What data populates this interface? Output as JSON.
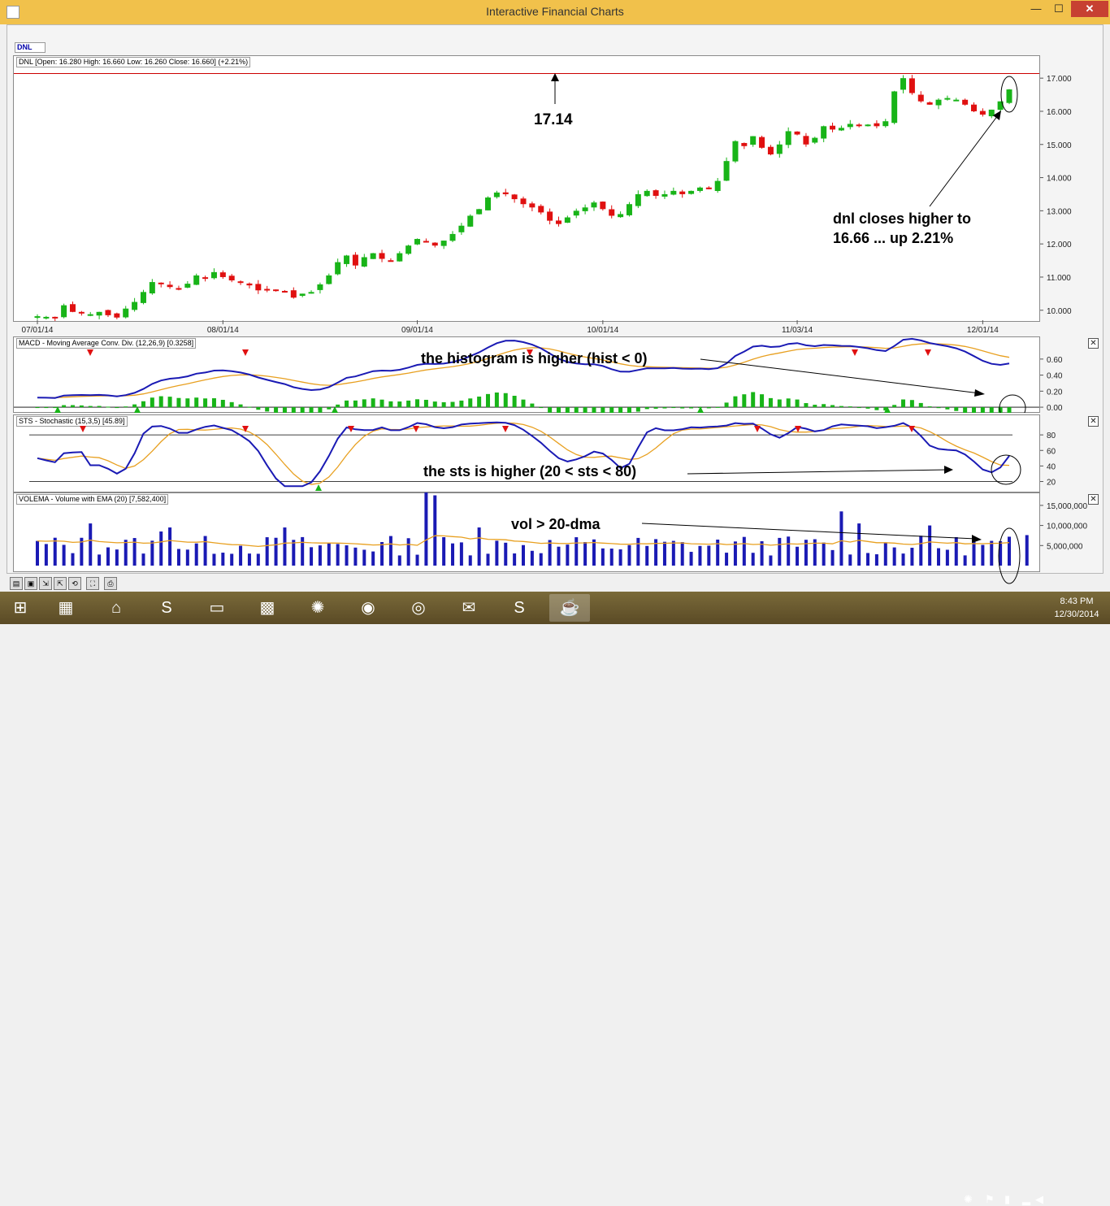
{
  "window": {
    "title": "Interactive Financial Charts",
    "min_label": "—",
    "max_label": "☐",
    "close_label": "✕"
  },
  "ticker_tab": "DNL",
  "panels": {
    "price_label": "DNL [Open: 16.280  High: 16.660  Low: 16.260  Close: 16.660] (+2.21%)",
    "macd_label": "MACD - Moving Average Conv. Div. (12,26,9) [0.3258]",
    "sts_label": "STS - Stochastic (15,3,5) [45.89]",
    "vol_label": "VOLEMA - Volume with EMA (20) [7,582,400]",
    "close_glyph": "✕"
  },
  "annotations": {
    "resistance": "17.14",
    "close_note_1": "dnl closes higher to",
    "close_note_2": "16.66 ... up 2.21%",
    "macd_note": "the histogram is higher (hist < 0)",
    "sts_note": "the sts is higher (20 < sts < 80)",
    "vol_note": "vol > 20-dma"
  },
  "colors": {
    "up": "#18b418",
    "down": "#e01010",
    "macd_line": "#1a1ab4",
    "signal_line": "#e8a020",
    "resistance_line": "#cc0000",
    "volume_bar": "#1a1ab4",
    "marker_up": "#18b418",
    "marker_down": "#e01010"
  },
  "chart_data": [
    {
      "type": "candlestick",
      "x_ticks": [
        "07/01/14",
        "08/01/14",
        "09/01/14",
        "10/01/14",
        "11/03/14",
        "12/01/14"
      ],
      "y_ticks": [
        "10.000",
        "11.000",
        "12.000",
        "13.000",
        "14.000",
        "15.000",
        "16.000",
        "17.000"
      ],
      "ylim": [
        9.7,
        17.2
      ],
      "resistance": 17.14,
      "closes": [
        9.82,
        9.8,
        9.78,
        10.15,
        9.95,
        9.92,
        9.88,
        9.95,
        9.85,
        9.78,
        10.05,
        10.25,
        10.55,
        10.85,
        10.8,
        10.7,
        10.65,
        10.8,
        11.05,
        10.95,
        11.15,
        11.0,
        10.9,
        10.85,
        10.75,
        10.6,
        10.62,
        10.6,
        10.58,
        10.38,
        10.5,
        10.55,
        10.78,
        11.05,
        11.45,
        11.65,
        11.35,
        11.6,
        11.72,
        11.55,
        11.5,
        11.72,
        11.95,
        12.15,
        12.05,
        11.95,
        12.1,
        12.3,
        12.55,
        12.85,
        13.05,
        13.4,
        13.55,
        13.5,
        13.35,
        13.2,
        13.1,
        12.95,
        12.7,
        12.6,
        12.8,
        13.0,
        13.1,
        13.25,
        13.05,
        12.85,
        12.9,
        13.2,
        13.5,
        13.6,
        13.45,
        13.5,
        13.6,
        13.5,
        13.6,
        13.7,
        13.65,
        13.9,
        14.5,
        15.1,
        14.95,
        15.25,
        14.9,
        14.7,
        15.0,
        15.4,
        15.3,
        15.0,
        15.2,
        15.55,
        15.45,
        15.5,
        15.62,
        15.58,
        15.6,
        15.55,
        15.7,
        16.6,
        17.0,
        16.55,
        16.3,
        16.2,
        16.35,
        16.4,
        16.35,
        16.2,
        16.0,
        15.9,
        16.05,
        16.3,
        16.66
      ],
      "volume_ylim": [
        0,
        17000000
      ],
      "volume_ticks": [
        "5,000,000",
        "10,000,000",
        "15,000,000"
      ]
    },
    {
      "type": "line",
      "name": "MACD",
      "y_ticks": [
        "0.00",
        "0.20",
        "0.40",
        "0.60"
      ],
      "ylim": [
        -0.05,
        0.72
      ]
    },
    {
      "type": "line",
      "name": "STS",
      "y_ticks": [
        "20",
        "40",
        "60",
        "80"
      ],
      "ylim": [
        8,
        100
      ]
    }
  ]
}
